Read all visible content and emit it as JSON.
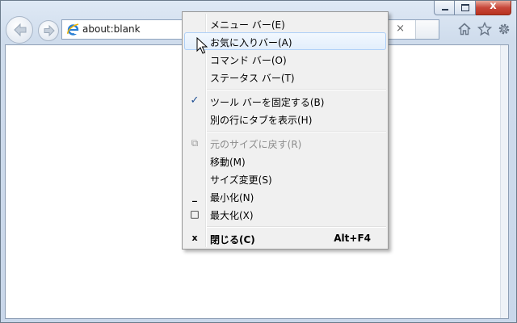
{
  "address_bar": {
    "url": "about:blank",
    "clear_glyph": "×"
  },
  "window": {
    "close_glyph": "x"
  },
  "icons": {
    "back": "back-arrow-icon",
    "forward": "forward-arrow-icon",
    "page": "ie-logo-icon",
    "home": "home-icon",
    "favorites": "star-icon",
    "tools": "gear-icon"
  },
  "context_menu": {
    "items": [
      {
        "label": "メニュー バー(E)"
      },
      {
        "label": "お気に入りバー(A)",
        "state": "hover"
      },
      {
        "label": "コマンド バー(O)"
      },
      {
        "label": "ステータス バー(T)"
      },
      {
        "label": "ツール バーを固定する(B)",
        "checked": true,
        "icon_glyph": "✓"
      },
      {
        "label": "別の行にタブを表示(H)"
      },
      {
        "label": "元のサイズに戻す(R)",
        "disabled": true,
        "icon_glyph": "⧉"
      },
      {
        "label": "移動(M)"
      },
      {
        "label": "サイズ変更(S)"
      },
      {
        "label": "最小化(N)",
        "icon_glyph": "_"
      },
      {
        "label": "最大化(X)",
        "icon_glyph": "□"
      },
      {
        "label": "閉じる(C)",
        "shortcut": "Alt+F4",
        "bold": true,
        "icon_glyph": "x"
      }
    ]
  },
  "colors": {
    "menu_hover_border": "#aecff7",
    "menu_check": "#1d4e93",
    "close_button": "#c7473a"
  }
}
